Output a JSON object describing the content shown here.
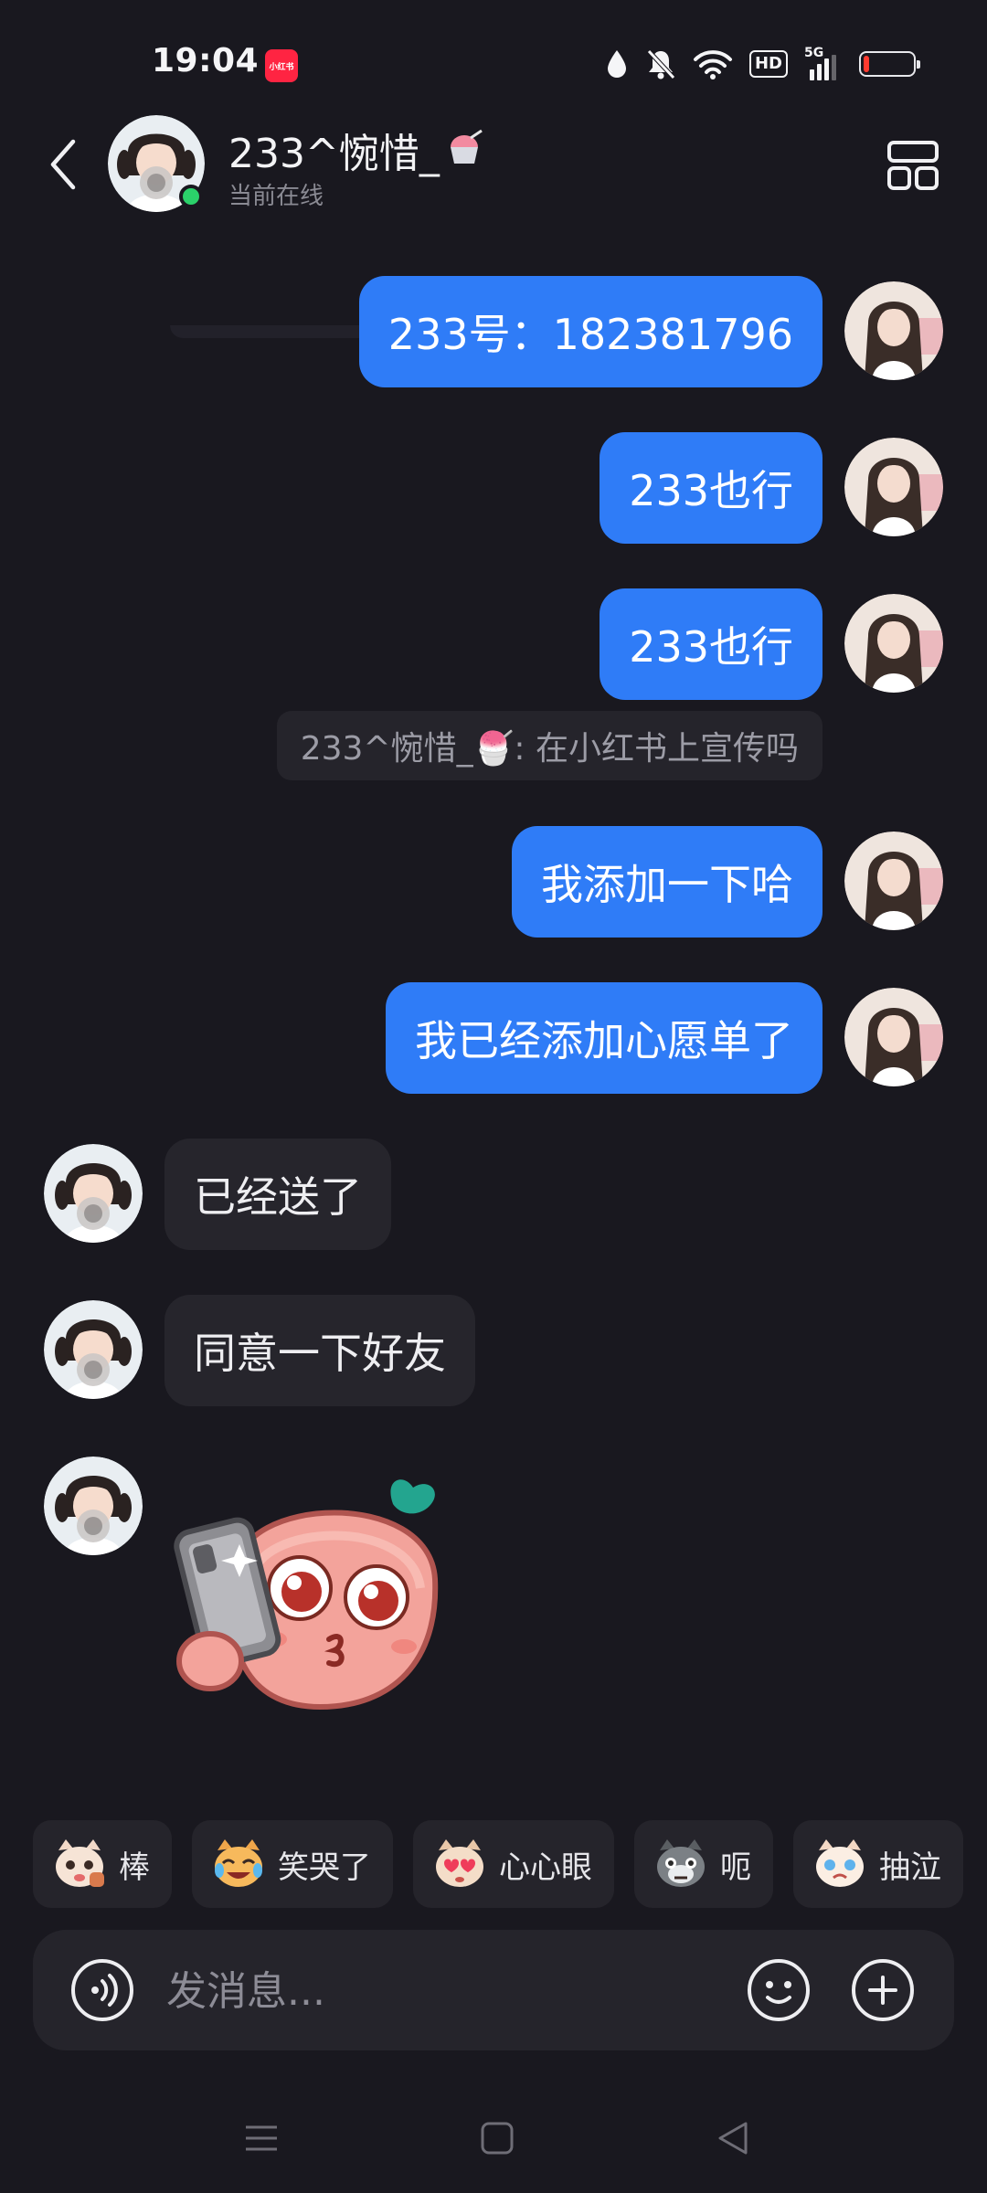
{
  "status_bar": {
    "time": "19:04",
    "app_badge": "小红书",
    "hd": "HD",
    "network": "5G",
    "battery_level": 0.1,
    "battery_color": "#ff3b30"
  },
  "header": {
    "contact_name": "233^惋惜_",
    "status": "当前在线",
    "online_color": "#2bd16a"
  },
  "messages": [
    {
      "side": "right",
      "type": "text",
      "text": "233号：182381796"
    },
    {
      "side": "right",
      "type": "text",
      "text": "233也行"
    },
    {
      "side": "right",
      "type": "text",
      "text": "233也行"
    },
    {
      "side": "right",
      "type": "quote",
      "text": "233^惋惜_🍧: 在小红书上宣传吗"
    },
    {
      "side": "right",
      "type": "text",
      "text": "我添加一下哈"
    },
    {
      "side": "right",
      "type": "text",
      "text": "我已经添加心愿单了"
    },
    {
      "side": "left",
      "type": "text",
      "text": "已经送了"
    },
    {
      "side": "left",
      "type": "text",
      "text": "同意一下好友"
    },
    {
      "side": "left",
      "type": "sticker",
      "sticker": "phone-kiss-sticker"
    }
  ],
  "quick_reactions": [
    {
      "label": "棒",
      "icon": "cat-thumbs-emoji"
    },
    {
      "label": "笑哭了",
      "icon": "cat-laugh-cry-emoji"
    },
    {
      "label": "心心眼",
      "icon": "cat-heart-eyes-emoji"
    },
    {
      "label": "呃",
      "icon": "cat-awkward-emoji"
    },
    {
      "label": "抽泣",
      "icon": "cat-sob-emoji"
    }
  ],
  "input": {
    "placeholder": "发消息..."
  },
  "colors": {
    "background": "#19181f",
    "bubble_out": "#2f7cf7",
    "bubble_in": "#26252c"
  }
}
